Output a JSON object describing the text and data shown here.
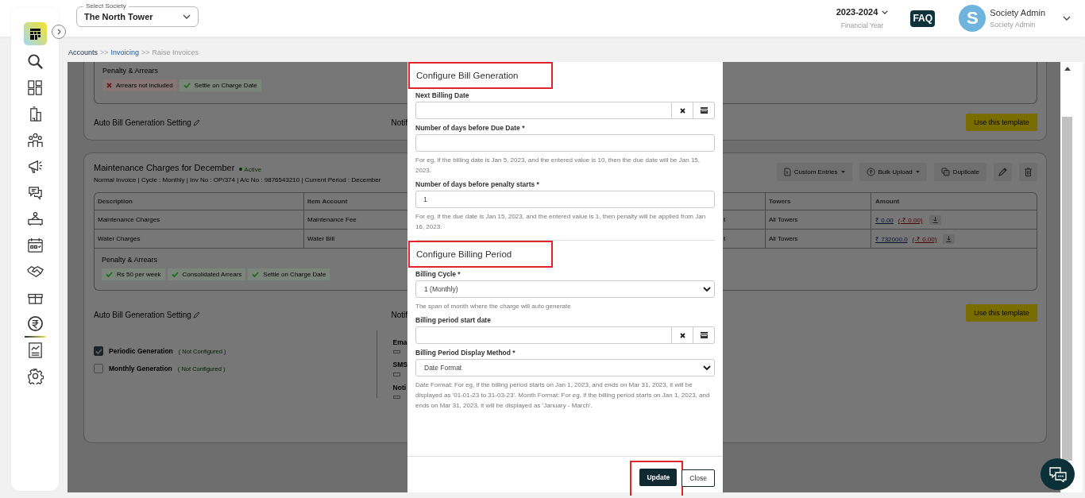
{
  "header": {
    "society_select": {
      "label": "Select Society",
      "value": "The North Tower"
    },
    "financial_year": {
      "value": "2023-2024",
      "caption": "Financial Year"
    },
    "faq": "FAQ",
    "user": {
      "initial": "S",
      "name": "Society Admin",
      "role": "Society Admin"
    }
  },
  "sidebar": {
    "items": [
      {
        "kind": "search",
        "selected": false
      },
      {
        "kind": "dashboard",
        "selected": false
      },
      {
        "kind": "building",
        "selected": false
      },
      {
        "kind": "people",
        "selected": false
      },
      {
        "kind": "megaphone",
        "selected": false
      },
      {
        "kind": "chat",
        "selected": false
      },
      {
        "kind": "desk",
        "selected": false
      },
      {
        "kind": "calendar",
        "selected": false
      },
      {
        "kind": "handshake",
        "selected": false
      },
      {
        "kind": "gift",
        "selected": false
      },
      {
        "kind": "rupee",
        "selected": true
      },
      {
        "kind": "report",
        "selected": false
      },
      {
        "kind": "settings",
        "selected": false
      }
    ]
  },
  "breadcrumb": {
    "separator": ">>",
    "items": [
      {
        "label": "Accounts",
        "kind": "root"
      },
      {
        "label": "Invoicing",
        "kind": "link"
      },
      {
        "label": "Raise Invoices",
        "kind": "current"
      }
    ]
  },
  "card_top": {
    "penalty_title": "Penalty & Arrears",
    "penalty_tags": [
      {
        "label": "Arrears not included",
        "included": false
      },
      {
        "label": "Settle on Charge Date",
        "included": true
      }
    ],
    "auto_bill_label": "Auto Bill Generation Setting",
    "notify_label": "Notif",
    "button": "Use this template"
  },
  "card_maintenance": {
    "title": "Maintenance Charges for December",
    "status": "Active",
    "meta": "Normal Invoice | Cycle : Monthly | Inv No : OP/374 | A/c No : 9876543210 | Current Period : December",
    "actions": [
      {
        "kind": "dropdown",
        "label": "Custom Entries"
      },
      {
        "kind": "dropdown",
        "label": "Bulk Upload"
      },
      {
        "kind": "button",
        "label": "Duplicate"
      },
      {
        "kind": "edit"
      },
      {
        "kind": "delete"
      }
    ],
    "table": {
      "columns_left": [
        "Description",
        "Item Account"
      ],
      "columns_right": [
        "Towers",
        "Amount"
      ],
      "rows": [
        {
          "description": "Maintenance Charges",
          "item_account": "Maintenance Fee",
          "column_3": "t",
          "towers": "All Towers",
          "amount": "₹ 0.00",
          "adjustment": "(-₹ 0.00)"
        },
        {
          "description": "Water Charges",
          "item_account": "Water Bill",
          "column_3": "t",
          "towers": "All Towers",
          "amount": "₹ 732000.0",
          "adjustment": "(-₹ 0.00)"
        }
      ],
      "penalty_title": "Penalty & Arrears",
      "penalty_tags": [
        {
          "label": "Rs 50 per week",
          "included": true
        },
        {
          "label": "Consolidated Arrears",
          "included": true
        },
        {
          "label": "Settle on Charge Date",
          "included": true
        }
      ]
    },
    "auto_bill_label": "Auto Bill Generation Setting",
    "notify_label": "Notif",
    "button": "Use this template",
    "generation_options": [
      {
        "label": "Periodic Generation",
        "status": "( Not Configured )",
        "checked": true
      },
      {
        "label": "Monthly Generation",
        "status": "( Not Configured )",
        "checked": false
      }
    ],
    "notify_groups": [
      {
        "title": "Ema",
        "checked": false
      },
      {
        "title": "SMS",
        "checked": false
      },
      {
        "title": "Noti",
        "checked": false
      }
    ]
  },
  "modal": {
    "sections": [
      {
        "title": "Configure Bill Generation",
        "highlighted": true,
        "fields": [
          {
            "kind": "date",
            "label": "Next Billing Date"
          },
          {
            "kind": "text",
            "label": "Number of days before Due Date *",
            "help": "For eg, if the billing date is Jan 5, 2023, and the entered value is 10, then the due date will be Jan 15, 2023."
          },
          {
            "kind": "text",
            "label": "Number of days before penalty starts *",
            "value": "1",
            "help": "For eg, if the due date is Jan 15, 2023, and the entered value is 1, then penalty will be applied from Jan 16, 2023."
          }
        ]
      },
      {
        "title": "Configure Billing Period",
        "highlighted": true,
        "fields": [
          {
            "kind": "select",
            "label": "Billing Cycle *",
            "value": "1 (Monthly)",
            "help": "The span of month where the charge will auto generate"
          },
          {
            "kind": "date",
            "label": "Billing period start date"
          },
          {
            "kind": "select",
            "label": "Billing Period Display Method *",
            "value": "Date Format",
            "help": "Date Format: For eg, if the billing period starts on Jan 1, 2023, and ends on Mar 31, 2023, it will be displayed as '01-01-23 to 31-03-23'. Month Format: For eg, if the billing period starts on Jan 1, 2023, and ends on Mar 31, 2023, it will be displayed as 'January - March'."
          }
        ]
      }
    ],
    "buttons": [
      {
        "label": "Update",
        "kind": "primary",
        "highlighted": true
      },
      {
        "label": "Close",
        "kind": "secondary",
        "highlighted": false
      }
    ]
  }
}
